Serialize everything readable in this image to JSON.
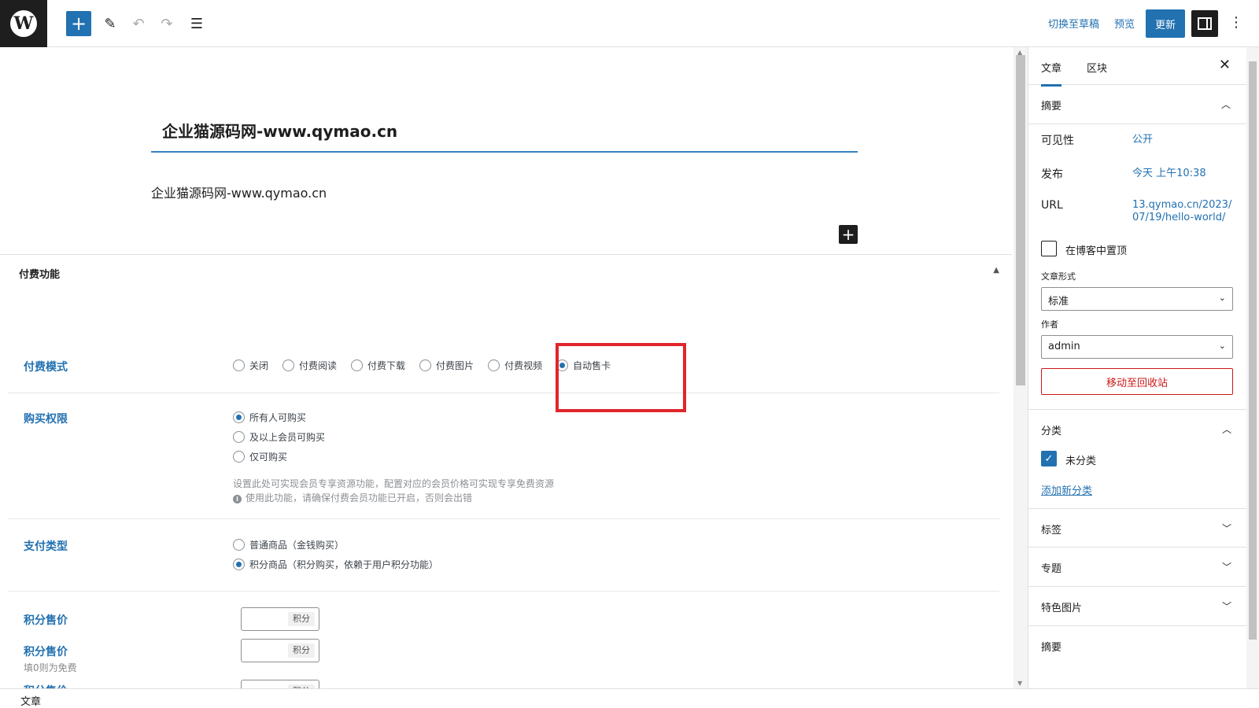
{
  "toolbar": {
    "logo": "W",
    "add_label": "+",
    "switch_draft": "切换至草稿",
    "preview": "预览",
    "update": "更新",
    "more": "⋮"
  },
  "post": {
    "title": "企业猫源码网-www.qymao.cn",
    "paragraph": "企业猫源码网-www.qymao.cn"
  },
  "metabox": {
    "title": "付费功能",
    "pay_mode": {
      "label": "付费模式",
      "options": [
        "关闭",
        "付费阅读",
        "付费下载",
        "付费图片",
        "付费视频",
        "自动售卡"
      ],
      "selected": "自动售卡"
    },
    "purchase_limit": {
      "label": "购买权限",
      "options": [
        "所有人可购买",
        "及以上会员可购买",
        "仅可购买"
      ],
      "selected": "所有人可购买",
      "desc": "设置此处可实现会员专享资源功能，配置对应的会员价格可实现专享免费资源",
      "note": "使用此功能，请确保付费会员功能已开启，否则会出错"
    },
    "pay_type": {
      "label": "支付类型",
      "options": [
        "普通商品（金钱购买）",
        "积分商品（积分购买，依赖于用户积分功能）"
      ],
      "selected": "积分商品（积分购买，依赖于用户积分功能）"
    },
    "price1": {
      "label": "积分售价",
      "unit": "积分",
      "value": ""
    },
    "price2": {
      "label": "积分售价",
      "sub": "填0则为免费",
      "unit": "积分",
      "value": ""
    },
    "price3": {
      "label": "积分售价",
      "unit": "积分"
    }
  },
  "sidebar": {
    "tabs": [
      "文章",
      "区块"
    ],
    "active_tab": "文章",
    "summary": {
      "title": "摘要",
      "visibility_label": "可见性",
      "visibility_value": "公开",
      "publish_label": "发布",
      "publish_value": "今天 上午10:38",
      "url_label": "URL",
      "url_value_1": "13.qymao.cn/2023/",
      "url_value_2": "07/19/hello-world/",
      "sticky_label": "在博客中置顶",
      "format_label": "文章形式",
      "format_value": "标准",
      "author_label": "作者",
      "author_value": "admin",
      "trash": "移动至回收站"
    },
    "categories": {
      "title": "分类",
      "item": "未分类",
      "add_new": "添加新分类"
    },
    "tags_title": "标签",
    "topics_title": "专题",
    "featured_title": "特色图片",
    "excerpt_title": "摘要"
  },
  "footer": {
    "breadcrumb": "文章"
  },
  "colors": {
    "accent": "#2271b1",
    "highlight": "#e0252b",
    "danger": "#cc1818"
  }
}
